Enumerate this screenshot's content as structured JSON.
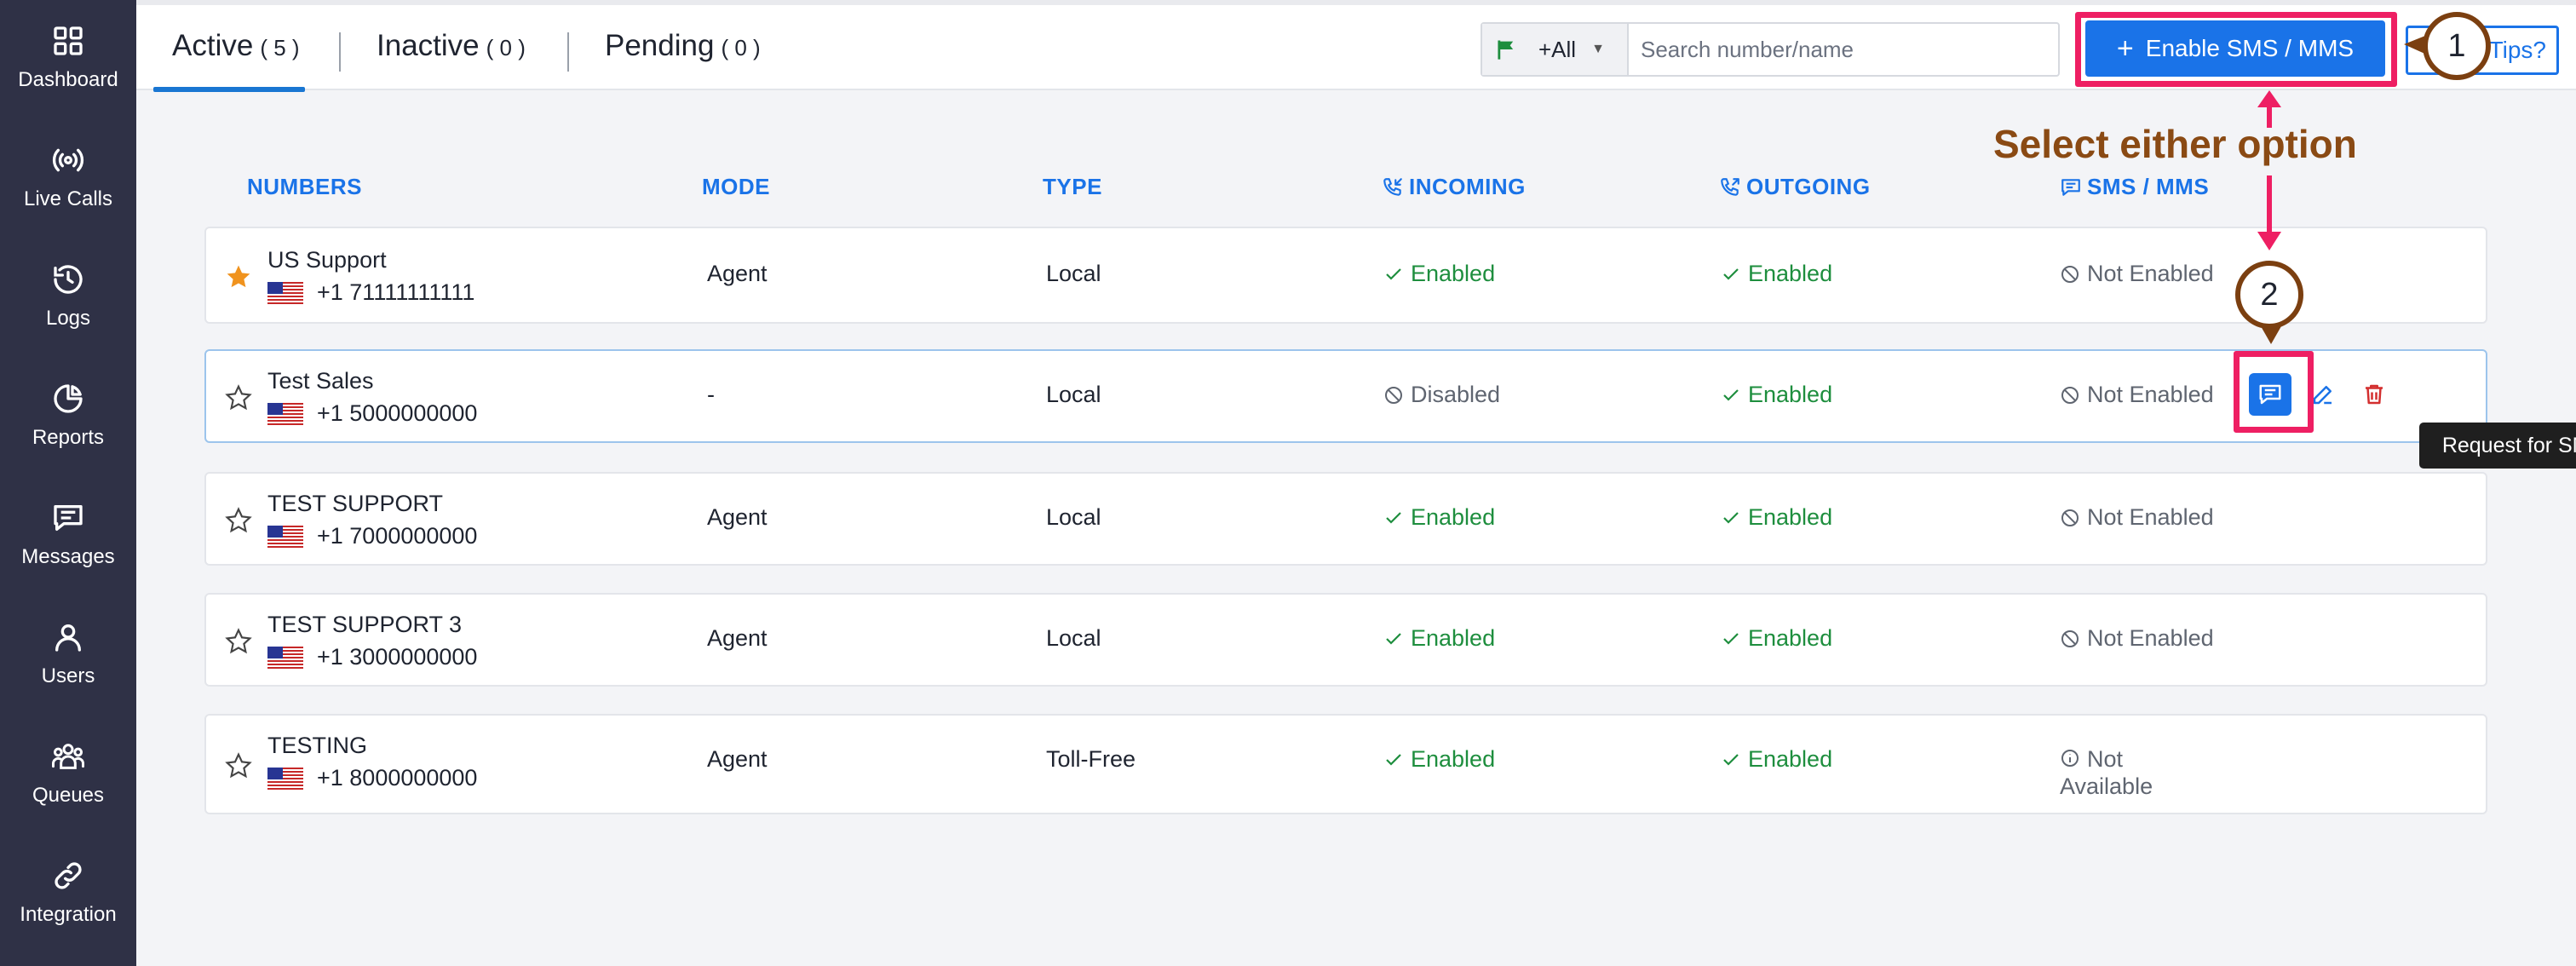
{
  "sidebar": {
    "items": [
      {
        "label": "Dashboard",
        "icon": "grid-icon"
      },
      {
        "label": "Live Calls",
        "icon": "broadcast-icon"
      },
      {
        "label": "Logs",
        "icon": "history-icon"
      },
      {
        "label": "Reports",
        "icon": "pie-chart-icon"
      },
      {
        "label": "Messages",
        "icon": "message-icon"
      },
      {
        "label": "Users",
        "icon": "user-icon"
      },
      {
        "label": "Queues",
        "icon": "group-icon"
      },
      {
        "label": "Integration",
        "icon": "link-icon"
      }
    ]
  },
  "tabs": [
    {
      "label": "Active",
      "count": "( 5 )",
      "active": true
    },
    {
      "label": "Inactive",
      "count": "( 0 )",
      "active": false
    },
    {
      "label": "Pending",
      "count": "( 0 )",
      "active": false
    }
  ],
  "search": {
    "country_prefix": "+All",
    "placeholder": "Search number/name",
    "value": ""
  },
  "toolbar": {
    "enable_label": "Enable SMS / MMS",
    "tips_label": "Tips?"
  },
  "annotations": {
    "callout_1": "1",
    "callout_2": "2",
    "hint": "Select either option",
    "tooltip": "Request for SMS",
    "highlight_color": "#ee1f63",
    "callout_color": "#7b3f10"
  },
  "table": {
    "headers": {
      "numbers": "NUMBERS",
      "mode": "MODE",
      "type": "TYPE",
      "incoming": "INCOMING",
      "outgoing": "OUTGOING",
      "sms": "SMS / MMS"
    },
    "rows": [
      {
        "name": "US Support",
        "number": "+1 71111111111",
        "mode": "Agent",
        "type": "Local",
        "incoming": "Enabled",
        "outgoing": "Enabled",
        "sms": "Not Enabled",
        "starred": true
      },
      {
        "name": "Test Sales",
        "number": "+1 5000000000",
        "mode": "-",
        "type": "Local",
        "incoming": "Disabled",
        "outgoing": "Enabled",
        "sms": "Not Enabled",
        "starred": false
      },
      {
        "name": "TEST SUPPORT",
        "number": "+1 7000000000",
        "mode": "Agent",
        "type": "Local",
        "incoming": "Enabled",
        "outgoing": "Enabled",
        "sms": "Not Enabled",
        "starred": false
      },
      {
        "name": "TEST SUPPORT 3",
        "number": "+1 3000000000",
        "mode": "Agent",
        "type": "Local",
        "incoming": "Enabled",
        "outgoing": "Enabled",
        "sms": "Not Enabled",
        "starred": false
      },
      {
        "name": "TESTING",
        "number": "+1 8000000000",
        "mode": "Agent",
        "type": "Toll-Free",
        "incoming": "Enabled",
        "outgoing": "Enabled",
        "sms_line1": "Not",
        "sms_line2": "Available",
        "starred": false
      }
    ]
  },
  "colors": {
    "sidebar_bg": "#2f3146",
    "accent": "#1a73e8",
    "enabled": "#1e8e3e",
    "delete": "#d32f2f",
    "star": "#f0931e"
  }
}
